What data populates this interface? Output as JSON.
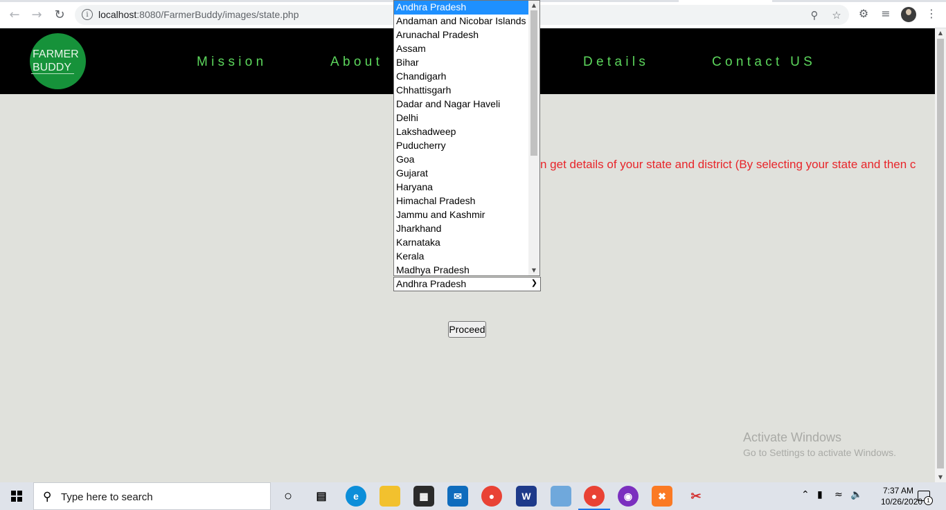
{
  "browser": {
    "url_host": "localhost",
    "url_path": ":8080/FarmerBuddy/images/state.php"
  },
  "header": {
    "logo_line1": "FARMER",
    "logo_line2": "BUDDY",
    "nav": [
      "Mission",
      "About",
      "Details",
      "Contact US"
    ]
  },
  "main": {
    "intro_text": "n get details of your state and district (By selecting your state and then c",
    "selected_state": "Andhra Pradesh",
    "proceed_label": "Proceed"
  },
  "dropdown": {
    "options": [
      "Andhra Pradesh",
      "Andaman and Nicobar Islands",
      "Arunachal Pradesh",
      "Assam",
      "Bihar",
      "Chandigarh",
      "Chhattisgarh",
      "Dadar and Nagar Haveli",
      "Delhi",
      "Lakshadweep",
      "Puducherry",
      "Goa",
      "Gujarat",
      "Haryana",
      "Himachal Pradesh",
      "Jammu and Kashmir",
      "Jharkhand",
      "Karnataka",
      "Kerala",
      "Madhya Pradesh"
    ]
  },
  "watermark": {
    "title": "Activate Windows",
    "subtitle": "Go to Settings to activate Windows."
  },
  "taskbar": {
    "search_placeholder": "Type here to search",
    "time": "7:37 AM",
    "date": "10/26/2020",
    "notification_count": "1"
  },
  "colors": {
    "page_bg": "#e0e1dc",
    "nav_text": "#5cd65c",
    "logo_bg": "#16923a",
    "intro_text": "#e8252a",
    "selected_option": "#1e90ff"
  }
}
